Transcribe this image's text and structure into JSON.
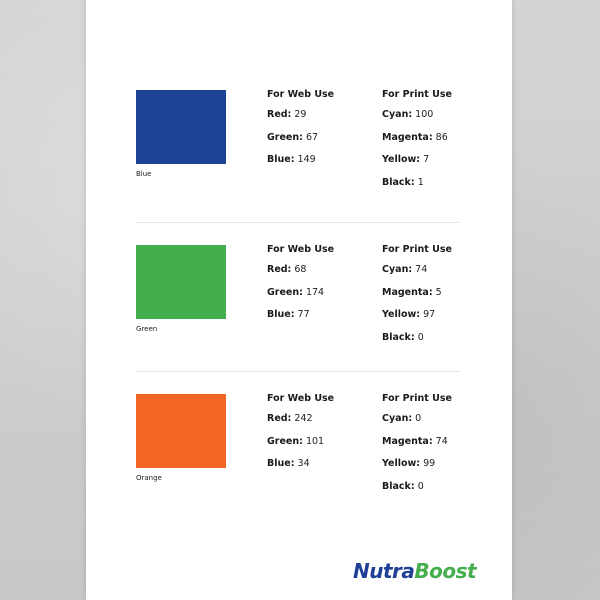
{
  "colors": [
    {
      "name": "Blue",
      "hex": "#1d4395",
      "web_heading": "For Web Use",
      "print_heading": "For Print Use",
      "web": [
        {
          "label": "Red:",
          "value": "29"
        },
        {
          "label": "Green:",
          "value": "67"
        },
        {
          "label": "Blue:",
          "value": "149"
        }
      ],
      "print": [
        {
          "label": "Cyan:",
          "value": "100"
        },
        {
          "label": "Magenta:",
          "value": "86"
        },
        {
          "label": "Yellow:",
          "value": "7"
        },
        {
          "label": "Black:",
          "value": "1"
        }
      ]
    },
    {
      "name": "Green",
      "hex": "#44ae4d",
      "web_heading": "For Web Use",
      "print_heading": "For Print Use",
      "web": [
        {
          "label": "Red:",
          "value": "68"
        },
        {
          "label": "Green:",
          "value": "174"
        },
        {
          "label": "Blue:",
          "value": "77"
        }
      ],
      "print": [
        {
          "label": "Cyan:",
          "value": "74"
        },
        {
          "label": "Magenta:",
          "value": "5"
        },
        {
          "label": "Yellow:",
          "value": "97"
        },
        {
          "label": "Black:",
          "value": "0"
        }
      ]
    },
    {
      "name": "Orange",
      "hex": "#f26522",
      "web_heading": "For Web Use",
      "print_heading": "For Print Use",
      "web": [
        {
          "label": "Red:",
          "value": "242"
        },
        {
          "label": "Green:",
          "value": "101"
        },
        {
          "label": "Blue:",
          "value": "34"
        }
      ],
      "print": [
        {
          "label": "Cyan:",
          "value": "0"
        },
        {
          "label": "Magenta:",
          "value": "74"
        },
        {
          "label": "Yellow:",
          "value": "99"
        },
        {
          "label": "Black:",
          "value": "0"
        }
      ]
    }
  ],
  "logo": {
    "part1": "Nutra",
    "part2": "Boost",
    "color1": "#1f3f97",
    "color2": "#44ae4d"
  }
}
